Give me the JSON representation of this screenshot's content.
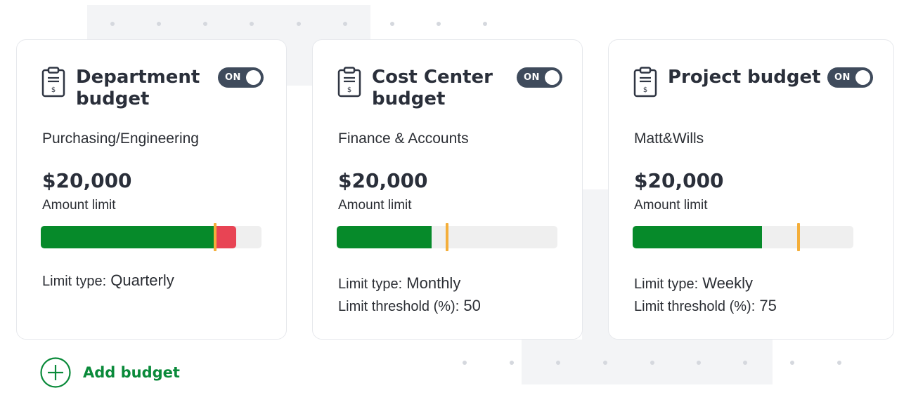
{
  "cards": [
    {
      "title": "Department budget",
      "toggle_label": "ON",
      "subtitle": "Purchasing/Engineering",
      "amount": "$20,000",
      "amount_label": "Amount limit",
      "progress": {
        "used_fraction": 0.79,
        "threshold_fraction": 0.79,
        "over_limit": true,
        "over_end_fraction": 0.885
      },
      "limit_type_label": "Limit type:",
      "limit_type_value": "Quarterly"
    },
    {
      "title": "Cost Center budget",
      "toggle_label": "ON",
      "subtitle": "Finance & Accounts",
      "amount": "$20,000",
      "amount_label": "Amount limit",
      "progress": {
        "used_fraction": 0.43,
        "threshold_fraction": 0.5,
        "over_limit": false
      },
      "limit_type_label": "Limit type:",
      "limit_type_value": "Monthly",
      "threshold_label": "Limit threshold (%):",
      "threshold_value": "50"
    },
    {
      "title": "Project budget",
      "toggle_label": "ON",
      "subtitle": "Matt&Wills",
      "amount": "$20,000",
      "amount_label": "Amount limit",
      "progress": {
        "used_fraction": 0.585,
        "threshold_fraction": 0.75,
        "over_limit": false
      },
      "limit_type_label": "Limit type:",
      "limit_type_value": "Weekly",
      "threshold_label": "Limit threshold (%):",
      "threshold_value": "75"
    }
  ],
  "add_budget": {
    "label": "Add budget"
  },
  "colors": {
    "accent_green": "#0a8a3a",
    "progress_green": "#068a2a",
    "over_limit_red": "#e84454",
    "threshold_marker": "#f4ae3a",
    "toggle_bg": "#3f4b5c"
  },
  "icons": {
    "card_icon": "clipboard-dollar-icon",
    "add_icon": "plus-circle-icon"
  }
}
